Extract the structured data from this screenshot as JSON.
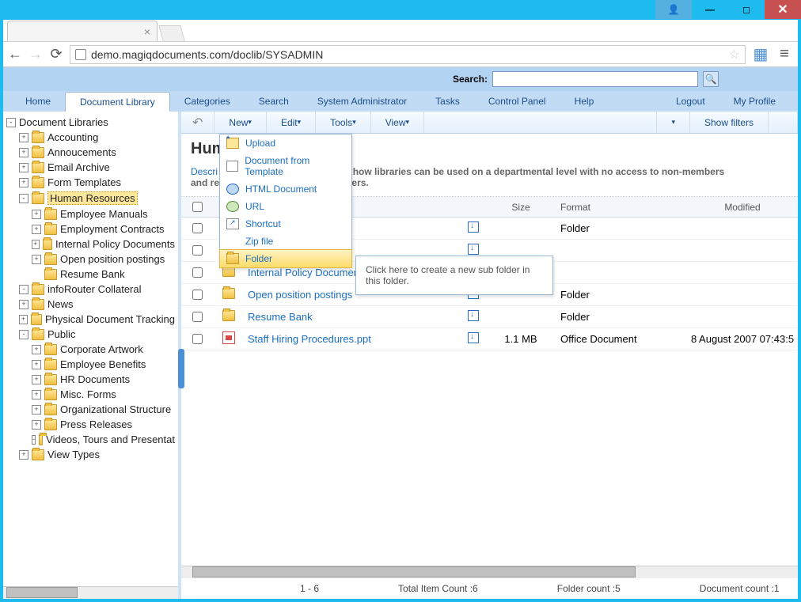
{
  "window": {
    "url": "demo.magiqdocuments.com/doclib/SYSADMIN"
  },
  "search": {
    "label": "Search:",
    "value": ""
  },
  "nav": {
    "tabs": [
      "Home",
      "Document Library",
      "Categories",
      "Search",
      "System Administrator",
      "Tasks",
      "Control Panel",
      "Help"
    ],
    "right": [
      "Logout",
      "My Profile"
    ],
    "active": "Document Library"
  },
  "tree": {
    "root": "Document Libraries",
    "items": [
      {
        "label": "Accounting",
        "level": 2,
        "tog": "+"
      },
      {
        "label": "Annoucements",
        "level": 2,
        "tog": "+"
      },
      {
        "label": "Email Archive",
        "level": 2,
        "tog": "+"
      },
      {
        "label": "Form Templates",
        "level": 2,
        "tog": "+"
      },
      {
        "label": "Human Resources",
        "level": 2,
        "tog": "-",
        "selected": true
      },
      {
        "label": "Employee Manuals",
        "level": 3,
        "tog": "+"
      },
      {
        "label": "Employment Contracts",
        "level": 3,
        "tog": "+"
      },
      {
        "label": "Internal Policy Documents",
        "level": 3,
        "tog": "+"
      },
      {
        "label": "Open position postings",
        "level": 3,
        "tog": "+"
      },
      {
        "label": "Resume Bank",
        "level": 3,
        "tog": ""
      },
      {
        "label": "infoRouter Collateral",
        "level": 2,
        "tog": "-"
      },
      {
        "label": "News",
        "level": 2,
        "tog": "+"
      },
      {
        "label": "Physical Document Tracking",
        "level": 2,
        "tog": "+"
      },
      {
        "label": "Public",
        "level": 2,
        "tog": "-"
      },
      {
        "label": "Corporate Artwork",
        "level": 3,
        "tog": "+"
      },
      {
        "label": "Employee Benefits",
        "level": 3,
        "tog": "+"
      },
      {
        "label": "HR Documents",
        "level": 3,
        "tog": "+"
      },
      {
        "label": "Misc. Forms",
        "level": 3,
        "tog": "+"
      },
      {
        "label": "Organizational Structure",
        "level": 3,
        "tog": "+"
      },
      {
        "label": "Press Releases",
        "level": 3,
        "tog": "+"
      },
      {
        "label": "Videos, Tours and Presentat",
        "level": 3,
        "tog": "-"
      },
      {
        "label": "View Types",
        "level": 2,
        "tog": "+"
      }
    ]
  },
  "toolbar": {
    "buttons": [
      "New",
      "Edit",
      "Tools",
      "View"
    ],
    "showfilters": "Show filters"
  },
  "dropdown": {
    "items": [
      "Upload",
      "Document from Template",
      "HTML Document",
      "URL",
      "Shortcut",
      "Zip file",
      "Folder"
    ],
    "tooltip": "Click here to create a new sub folder in this folder."
  },
  "page": {
    "title": "Hum",
    "desc_label": "Descri",
    "desc_text": "onstrate how libraries can be used on a departmental level with no access to non-members",
    "desc_line2": "and res",
    "desc_line2b": "l users."
  },
  "table": {
    "headers": {
      "name": "e",
      "size": "Size",
      "format": "Format",
      "modified": "Modified"
    },
    "rows": [
      {
        "name": "",
        "type": "folder",
        "size": "",
        "format": "Folder",
        "modified": ""
      },
      {
        "name": "",
        "type": "folder",
        "size": "",
        "format": "",
        "modified": ""
      },
      {
        "name": "Internal Policy Document",
        "type": "folder",
        "size": "",
        "format": "",
        "modified": ""
      },
      {
        "name": "Open position postings",
        "type": "folder",
        "size": "",
        "format": "Folder",
        "modified": ""
      },
      {
        "name": "Resume Bank",
        "type": "folder",
        "size": "",
        "format": "Folder",
        "modified": ""
      },
      {
        "name": "Staff Hiring Procedures.ppt",
        "type": "ppt",
        "size": "1.1 MB",
        "format": "Office Document",
        "modified": "8 August 2007 07:43:5"
      }
    ]
  },
  "status": {
    "range": "1 - 6",
    "total": "Total Item Count :6",
    "folders": "Folder count :5",
    "docs": "Document count :1"
  }
}
